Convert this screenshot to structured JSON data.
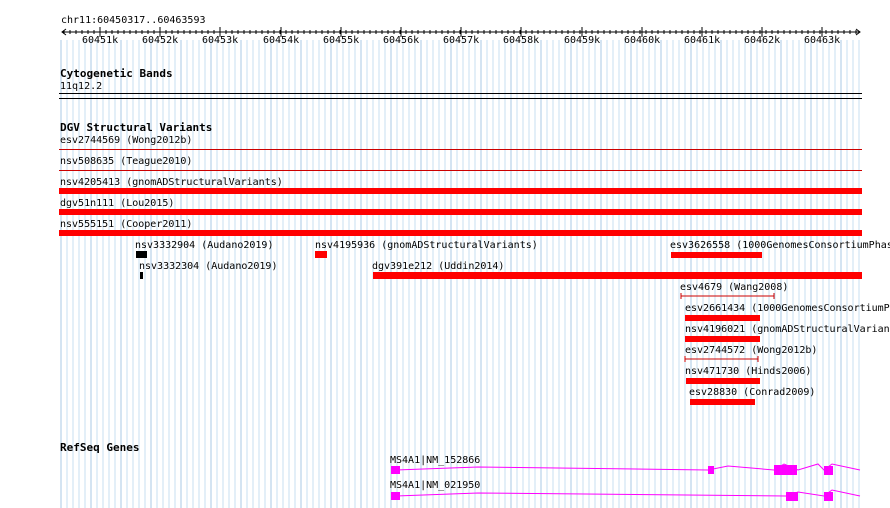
{
  "ruler": {
    "location": "chr11:60450317..60463593",
    "ticks": [
      "60451k",
      "60452k",
      "60453k",
      "60454k",
      "60455k",
      "60456k",
      "60457k",
      "60458k",
      "60459k",
      "60460k",
      "60461k",
      "60462k",
      "60463k"
    ]
  },
  "cytogenetic": {
    "title": "Cytogenetic Bands",
    "band": "11q12.2"
  },
  "dgv": {
    "title": "DGV Structural Variants",
    "variants": [
      {
        "label": "esv2744569 (Wong2012b)"
      },
      {
        "label": "nsv508635 (Teague2010)"
      },
      {
        "label": "nsv4205413 (gnomADStructuralVariants)"
      },
      {
        "label": "dgv51n111 (Lou2015)"
      },
      {
        "label": "nsv555151 (Cooper2011)"
      },
      {
        "label": "nsv3332904 (Audano2019)"
      },
      {
        "label": "nsv3332304 (Audano2019)"
      },
      {
        "label": "nsv4195936 (gnomADStructuralVariants)"
      },
      {
        "label": "dgv391e212 (Uddin2014)"
      },
      {
        "label": "esv3626558 (1000GenomesConsortiumPhas"
      },
      {
        "label": "esv4679 (Wang2008)"
      },
      {
        "label": "esv2661434 (1000GenomesConsortiumPh"
      },
      {
        "label": "nsv4196021 (gnomADStructuralVariant"
      },
      {
        "label": "esv2744572 (Wong2012b)"
      },
      {
        "label": "nsv471730 (Hinds2006)"
      },
      {
        "label": "esv28830 (Conrad2009)"
      }
    ]
  },
  "refseq": {
    "title": "RefSeq Genes",
    "genes": [
      {
        "label": "MS4A1|NM_152866"
      },
      {
        "label": "MS4A1|NM_021950"
      }
    ]
  },
  "colors": {
    "variant": "#ff0000",
    "variant_thin": "#cc0000",
    "gene": "#ff00ff",
    "grid": "#c7dff2"
  }
}
